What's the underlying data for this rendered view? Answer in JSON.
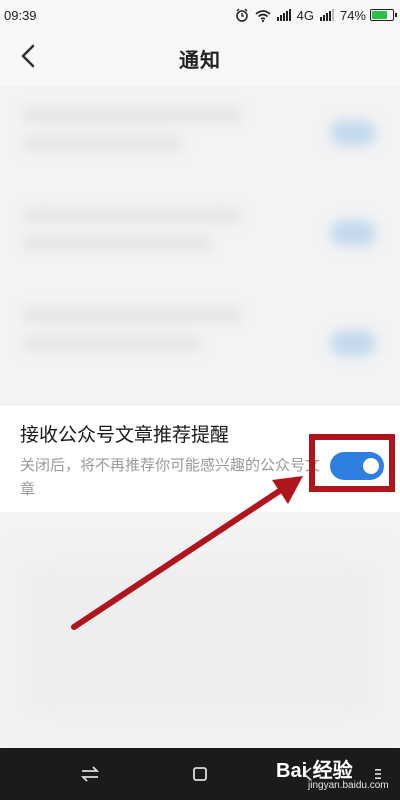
{
  "status_bar": {
    "time": "09:39",
    "network": "4G",
    "battery_percent": "74%",
    "battery_level": 0.74,
    "icons": [
      "alarm-icon",
      "wifi-icon",
      "signal-icon",
      "signal-icon",
      "battery-icon"
    ]
  },
  "header": {
    "title": "通知",
    "back_icon": "chevron-left-icon"
  },
  "setting": {
    "title": "接收公众号文章推荐提醒",
    "description": "关闭后，将不再推荐你可能感兴趣的公众号文章",
    "toggle_on": true,
    "toggle_color": "#2f7fe0"
  },
  "annotation": {
    "box_color": "#b0141c",
    "arrow_color": "#b0141c"
  },
  "nav_bar": {
    "buttons": [
      "switch-icon",
      "home-square-icon",
      "back-icon",
      "menu-icon"
    ]
  },
  "watermark": {
    "main": "Bai 经验",
    "sub": "jingyan.baidu.com"
  }
}
